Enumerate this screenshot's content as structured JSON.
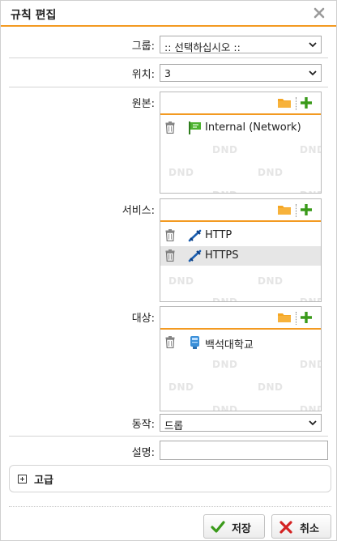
{
  "dialog": {
    "title": "규칙 편집",
    "close_icon": "close-icon"
  },
  "group": {
    "label": "그룹:",
    "value": ":: 선택하십시오 ::"
  },
  "position": {
    "label": "위치:",
    "value": "3"
  },
  "source": {
    "label": "원본:",
    "items": [
      {
        "icon": "network-flag-icon",
        "text": "Internal (Network)",
        "selected": false
      }
    ]
  },
  "services": {
    "label": "서비스:",
    "items": [
      {
        "icon": "service-link-icon",
        "text": "HTTP",
        "selected": false
      },
      {
        "icon": "service-link-icon",
        "text": "HTTPS",
        "selected": true
      }
    ]
  },
  "destination": {
    "label": "대상:",
    "items": [
      {
        "icon": "host-icon",
        "text": "백석대학교",
        "selected": false
      }
    ]
  },
  "dnd_watermark": "DND",
  "action": {
    "label": "동작:",
    "value": "드롭"
  },
  "description": {
    "label": "설명:",
    "value": ""
  },
  "advanced": {
    "label": "고급"
  },
  "buttons": {
    "save": "저장",
    "cancel": "취소"
  },
  "colors": {
    "accent": "#f39a21",
    "add_green": "#3a9a1a",
    "cancel_red": "#d42222",
    "link_blue": "#1c5fb0"
  }
}
